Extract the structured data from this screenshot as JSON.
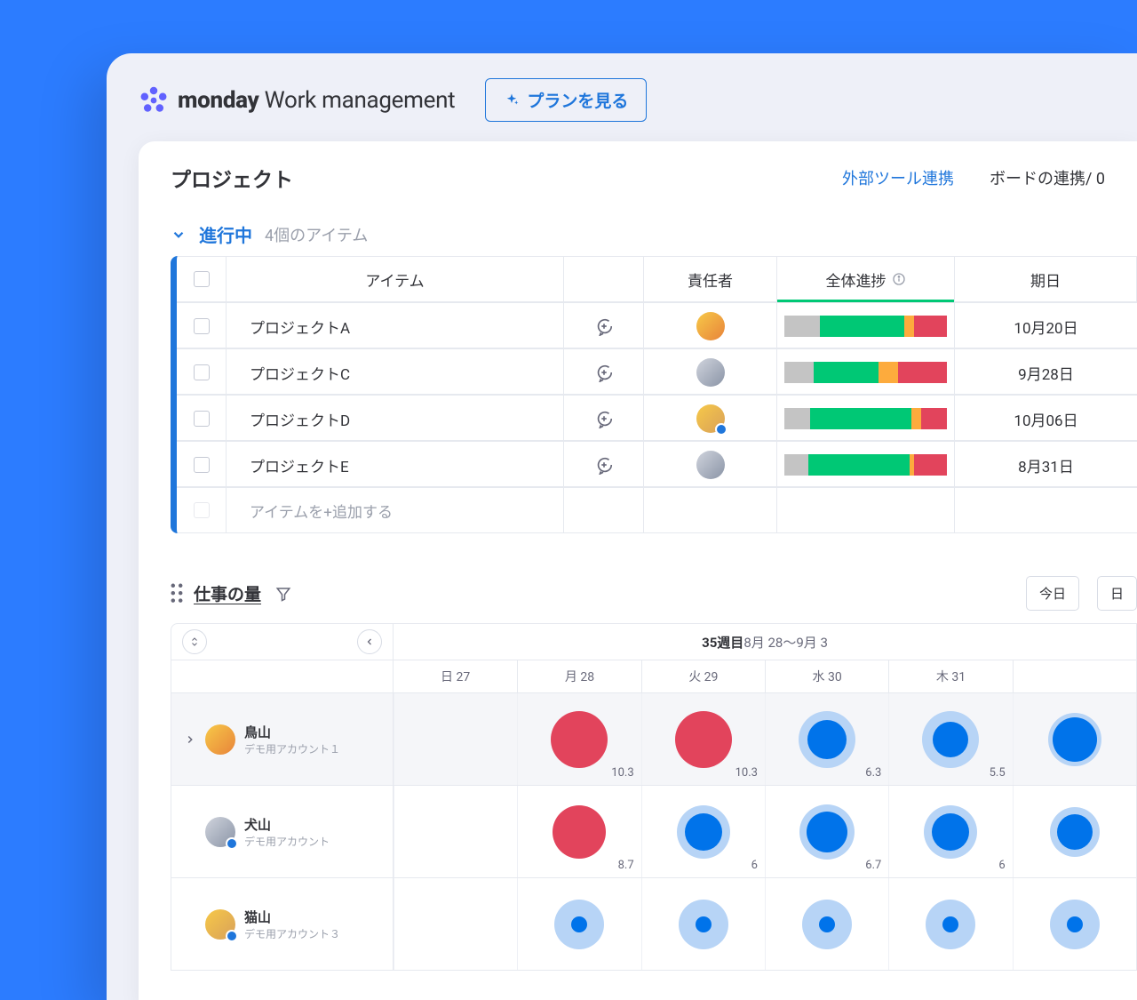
{
  "brand": {
    "name_bold": "monday",
    "name_rest": " Work management"
  },
  "header": {
    "plan_button": "プランを見る"
  },
  "board": {
    "title": "プロジェクト",
    "external_link": "外部ツール連携",
    "board_link_label": "ボードの連携/ 0"
  },
  "group": {
    "name": "進行中",
    "count_label": "4個のアイテム"
  },
  "columns": {
    "item": "アイテム",
    "owner": "責任者",
    "progress": "全体進捗",
    "due": "期日"
  },
  "rows": [
    {
      "name": "プロジェクトA",
      "avatar": "av1",
      "badge": false,
      "progress": {
        "grey": 22,
        "green": 52,
        "orange": 6,
        "red": 20
      },
      "due": "10月20日"
    },
    {
      "name": "プロジェクトC",
      "avatar": "av2",
      "badge": false,
      "progress": {
        "grey": 18,
        "green": 40,
        "orange": 12,
        "red": 30
      },
      "due": "9月28日"
    },
    {
      "name": "プロジェクトD",
      "avatar": "av3",
      "badge": true,
      "progress": {
        "grey": 16,
        "green": 62,
        "orange": 6,
        "red": 16
      },
      "due": "10月06日"
    },
    {
      "name": "プロジェクトE",
      "avatar": "av2",
      "badge": false,
      "progress": {
        "grey": 15,
        "green": 62,
        "orange": 3,
        "red": 20
      },
      "due": "8月31日"
    }
  ],
  "add_item_placeholder": "アイテムを+追加する",
  "workload": {
    "title": "仕事の量",
    "today_btn": "今日",
    "day_btn": "日",
    "week_label_bold": "35週目",
    "week_label_rest": "8月 28〜9月 3",
    "day_headers": [
      "日 27",
      "月 28",
      "火 29",
      "水 30",
      "木 31",
      ""
    ],
    "people": [
      {
        "name": "鳥山",
        "sub": "デモ用アカウント１",
        "avatar": "av1",
        "badge": false,
        "expand": true,
        "cells": [
          {},
          {
            "color": "red",
            "outer": 64,
            "inner": 64,
            "val": "10.3"
          },
          {
            "color": "red",
            "outer": 64,
            "inner": 64,
            "val": "10.3"
          },
          {
            "color": "blue",
            "outer": 64,
            "inner": 44,
            "val": "6.3"
          },
          {
            "color": "blue",
            "outer": 64,
            "inner": 40,
            "val": "5.5"
          },
          {
            "color": "blue",
            "outer": 60,
            "inner": 50
          }
        ]
      },
      {
        "name": "犬山",
        "sub": "デモ用アカウント",
        "avatar": "av2",
        "badge": true,
        "expand": false,
        "cells": [
          {},
          {
            "color": "red",
            "outer": 60,
            "inner": 60,
            "val": "8.7"
          },
          {
            "color": "blue",
            "outer": 60,
            "inner": 42,
            "val": "6"
          },
          {
            "color": "blue",
            "outer": 62,
            "inner": 46,
            "val": "6.7"
          },
          {
            "color": "blue",
            "outer": 60,
            "inner": 42,
            "val": "6"
          },
          {
            "color": "blue",
            "outer": 56,
            "inner": 40
          }
        ]
      },
      {
        "name": "猫山",
        "sub": "デモ用アカウント３",
        "avatar": "av3",
        "badge": true,
        "expand": false,
        "cells": [
          {},
          {
            "color": "blue",
            "outer": 56,
            "inner": 18
          },
          {
            "color": "blue",
            "outer": 56,
            "inner": 18
          },
          {
            "color": "blue",
            "outer": 56,
            "inner": 18
          },
          {
            "color": "blue",
            "outer": 56,
            "inner": 18
          },
          {
            "color": "blue",
            "outer": 56,
            "inner": 18
          }
        ]
      }
    ]
  }
}
